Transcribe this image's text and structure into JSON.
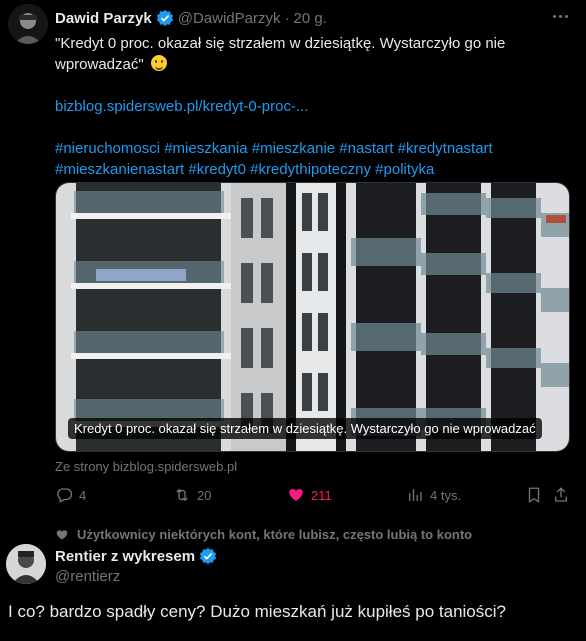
{
  "tweet": {
    "author_name": "Dawid Parzyk",
    "handle": "@DawidParzyk",
    "separator": "·",
    "time": "20 g.",
    "text_line1": "\"Kredyt 0 proc. okazał się strzałem w dziesiątkę. Wystarczyło go nie",
    "text_line2": "wprowadzać\"",
    "emoji": "grinning-face",
    "link": "bizblog.spidersweb.pl/kredyt-0-proc-...",
    "hashtags_line1": "#nieruchomosci #mieszkania #mieszkanie #nastart #kredytnastart",
    "hashtags_line2": "#mieszkanienastart #kredyt0 #kredythipoteczny #polityka",
    "media_caption": "Kredyt 0 proc. okazał się strzałem w dziesiątkę. Wystarczyło go nie wprowadzać",
    "source": "Ze strony bizblog.spidersweb.pl",
    "replies": "4",
    "retweets": "20",
    "likes": "211",
    "views": "4 tys."
  },
  "social_context": "Użytkownicy niektórych kont, które lubisz, często lubią to konto",
  "reply": {
    "author_name": "Rentier z wykresem",
    "handle": "@rentierz",
    "text": "I co? bardzo spadły ceny? Dużo mieszkań już kupiłeś po taniości?"
  },
  "colors": {
    "background": "#000000",
    "text": "#e7e9ea",
    "muted": "#71767b",
    "link": "#1d9bf0",
    "like": "#f91880",
    "verified": "#1d9bf0"
  }
}
